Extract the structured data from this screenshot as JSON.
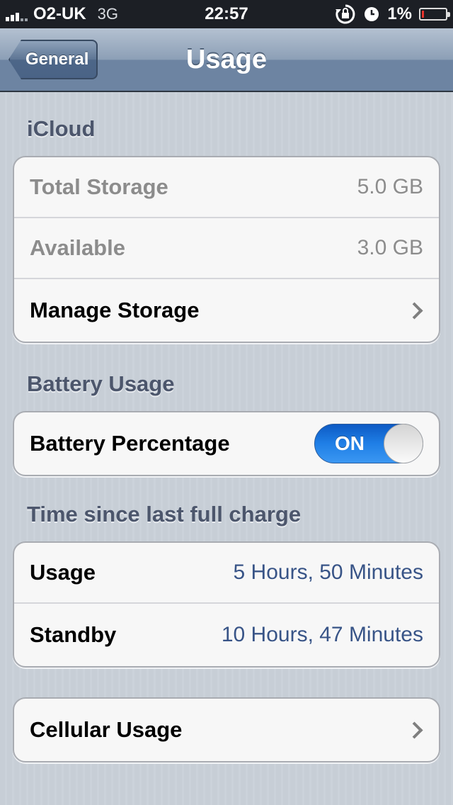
{
  "status_bar": {
    "carrier": "O2-UK",
    "network": "3G",
    "time": "22:57",
    "battery_percent": "1%",
    "icons": [
      "signal-icon",
      "rotation-lock-icon",
      "alarm-clock-icon",
      "battery-icon"
    ]
  },
  "nav": {
    "back_label": "General",
    "title": "Usage"
  },
  "icloud": {
    "header": "iCloud",
    "rows": [
      {
        "label": "Total Storage",
        "value": "5.0 GB"
      },
      {
        "label": "Available",
        "value": "3.0 GB"
      },
      {
        "label": "Manage Storage"
      }
    ]
  },
  "battery": {
    "header": "Battery Usage",
    "percentage_label": "Battery Percentage",
    "toggle_label": "ON",
    "toggle_state": true
  },
  "charge": {
    "header": "Time since last full charge",
    "rows": [
      {
        "label": "Usage",
        "value": "5 Hours, 50 Minutes"
      },
      {
        "label": "Standby",
        "value": "10 Hours, 47 Minutes"
      }
    ]
  },
  "cellular": {
    "label": "Cellular Usage"
  },
  "colors": {
    "value_blue": "#385487",
    "toggle_blue": "#1f7fe6",
    "battery_low": "#e8322b"
  }
}
